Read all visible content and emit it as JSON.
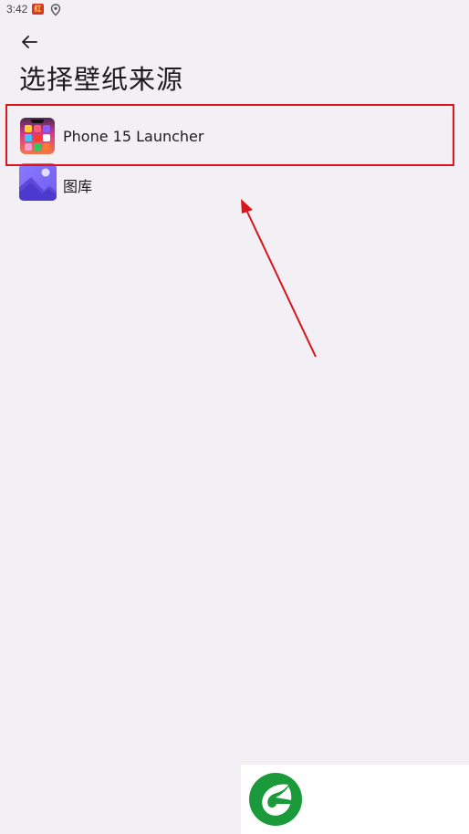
{
  "status_bar": {
    "time": "3:42",
    "app_icon": "notification-app-icon",
    "app_icon_glyph": "红",
    "location_icon": "location-pin-icon"
  },
  "header": {
    "back_icon": "arrow-left-icon",
    "title": "选择壁纸来源"
  },
  "wallpaper_sources": {
    "items": [
      {
        "label": "Phone 15 Launcher",
        "icon": "phone-launcher-app-icon"
      },
      {
        "label": "图库",
        "icon": "gallery-icon"
      }
    ]
  },
  "annotation": {
    "highlight_color": "#e0151c",
    "arrow_color": "#d8151b"
  },
  "watermark": {
    "logo_icon": "green-leaf-logo-icon",
    "logo_color": "#1a9a3a"
  }
}
